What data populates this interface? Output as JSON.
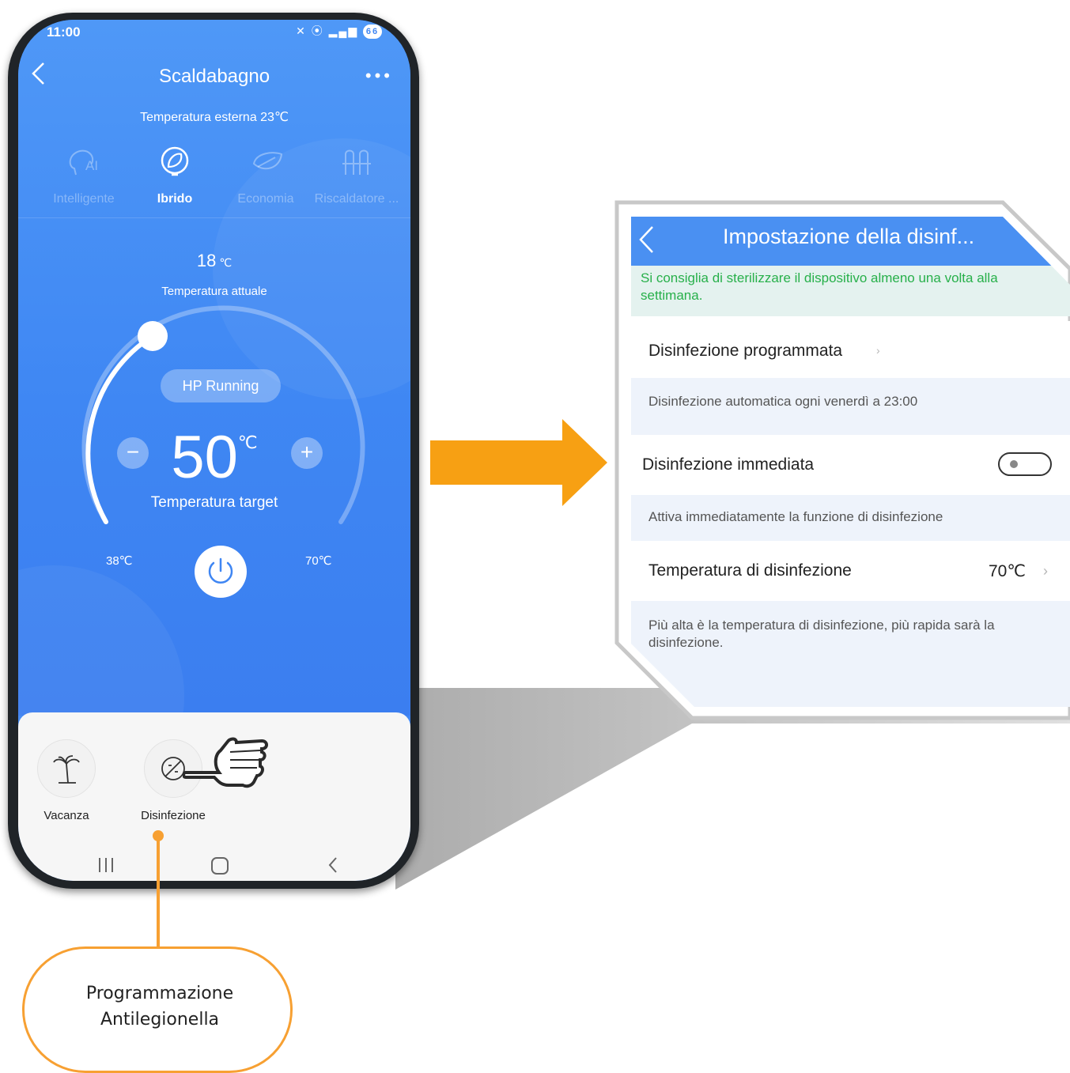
{
  "phone": {
    "status": {
      "time": "11:00",
      "battery": "66"
    },
    "title": "Scaldabagno",
    "outside_temp": "Temperatura esterna 23℃",
    "modes": [
      {
        "label": "Intelligente",
        "icon": "ai-head-icon",
        "active": false
      },
      {
        "label": "Ibrido",
        "icon": "hybrid-icon",
        "active": true
      },
      {
        "label": "Economia",
        "icon": "leaf-icon",
        "active": false
      },
      {
        "label": "Riscaldatore ...",
        "icon": "heater-coil-icon",
        "active": false
      }
    ],
    "current_temp": {
      "value": "18",
      "unit": "℃",
      "label": "Temperatura attuale"
    },
    "status_pill": "HP Running",
    "target_temp": {
      "value": "50",
      "unit": "℃",
      "label": "Temperatura target"
    },
    "range": {
      "min": "38℃",
      "max": "70℃"
    },
    "features": [
      {
        "label": "Vacanza",
        "icon": "palm-tree-icon"
      },
      {
        "label": "Disinfezione",
        "icon": "disinfection-icon"
      }
    ]
  },
  "panel": {
    "title": "Impostazione della disinf...",
    "tip": "Si consiglia di sterilizzare il dispositivo almeno una volta alla settimana.",
    "scheduled": {
      "label": "Disinfezione programmata",
      "desc": "Disinfezione automatica ogni venerdì a 23:00"
    },
    "immediate": {
      "label": "Disinfezione immediata",
      "enabled": false,
      "desc": "Attiva immediatamente la funzione di disinfezione"
    },
    "temperature": {
      "label": "Temperatura di disinfezione",
      "value": "70℃",
      "desc": "Più alta è la temperatura di disinfezione, più rapida sarà la disinfezione."
    }
  },
  "callout": {
    "line1": "Programmazione",
    "line2": "Antilegionella"
  },
  "colors": {
    "app_blue": "#3f86f3",
    "panel_header": "#4a90f2",
    "accent_orange": "#f7a032",
    "tip_green": "#27b04a"
  }
}
